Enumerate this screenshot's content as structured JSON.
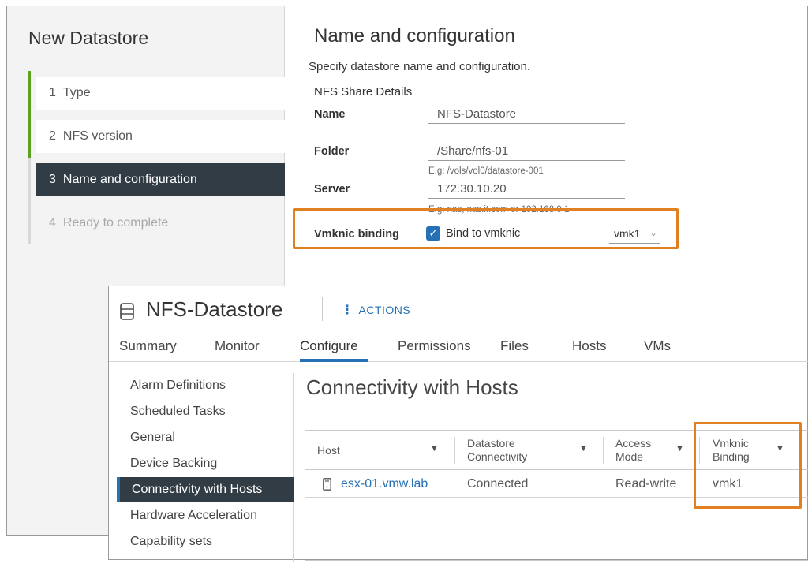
{
  "wizard": {
    "title": "New Datastore",
    "steps": [
      {
        "num": "1",
        "label": "Type"
      },
      {
        "num": "2",
        "label": "NFS version"
      },
      {
        "num": "3",
        "label": "Name and configuration"
      },
      {
        "num": "4",
        "label": "Ready to complete"
      }
    ],
    "main": {
      "title": "Name and configuration",
      "description": "Specify datastore name and configuration.",
      "section_heading": "NFS Share Details",
      "name_label": "Name",
      "name_value": "NFS-Datastore",
      "folder_label": "Folder",
      "folder_value": "/Share/nfs-01",
      "folder_hint": "E.g: /vols/vol0/datastore-001",
      "server_label": "Server",
      "server_value": "172.30.10.20",
      "server_hint": "E.g: nas, nas.it.com or 192.168.0.1",
      "vmknic_label": "Vmknic binding",
      "bind_checkbox_label": "Bind to vmknic",
      "bind_checked": true,
      "vmknic_selected": "vmk1"
    }
  },
  "datastore": {
    "title": "NFS-Datastore",
    "actions_label": "ACTIONS",
    "tabs": [
      "Summary",
      "Monitor",
      "Configure",
      "Permissions",
      "Files",
      "Hosts",
      "VMs"
    ],
    "active_tab": "Configure",
    "nav": [
      "Alarm Definitions",
      "Scheduled Tasks",
      "General",
      "Device Backing",
      "Connectivity with Hosts",
      "Hardware Acceleration",
      "Capability sets"
    ],
    "active_nav": "Connectivity with Hosts",
    "section_title": "Connectivity with Hosts",
    "grid": {
      "columns": [
        {
          "line1": "Host",
          "line2": ""
        },
        {
          "line1": "Datastore",
          "line2": "Connectivity"
        },
        {
          "line1": "Access",
          "line2": "Mode"
        },
        {
          "line1": "Vmknic",
          "line2": "Binding"
        }
      ],
      "rows": [
        {
          "host": "esx-01.vmw.lab",
          "connectivity": "Connected",
          "access": "Read-write",
          "binding": "vmk1"
        }
      ]
    }
  },
  "colors": {
    "accent_blue": "#2670b5",
    "highlight_orange": "#e08021",
    "done_green": "#5aa220",
    "active_dark": "#313c45"
  },
  "icons": [
    "database-icon",
    "actions-dots-icon",
    "filter-icon",
    "host-server-icon",
    "checkmark-icon",
    "chevron-down-icon"
  ]
}
